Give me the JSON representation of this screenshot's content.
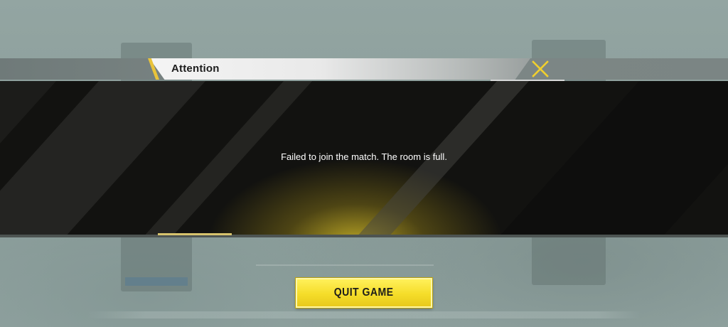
{
  "dialog": {
    "title": "Attention",
    "message": "Failed to join the match. The room is full.",
    "close_icon": "close-x-icon"
  },
  "actions": {
    "quit_label": "QUIT GAME"
  },
  "colors": {
    "accent_yellow": "#f5dd29",
    "close_icon": "#f0cf2e",
    "panel_bg": "#121210",
    "title_bar_bg": "#e9e9e9"
  }
}
